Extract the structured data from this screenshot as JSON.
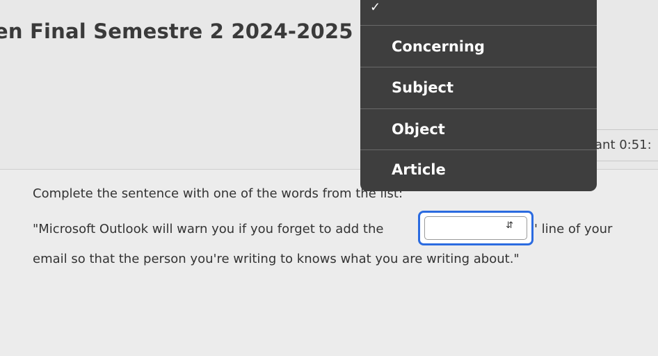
{
  "page": {
    "title": "en Final Semestre 2 2024-2025 (",
    "timer_text": "ant 0:51:"
  },
  "question": {
    "prompt": "Complete the sentence with one of the words from the list:",
    "sentence_before": "\"Microsoft Outlook will warn you if you forget to add the",
    "sentence_after": "' line of your",
    "sentence_line2": "email so that the person you're writing to knows what you are writing about.\"",
    "dropdown_value": ""
  },
  "menu": {
    "selected_index": -1,
    "items": [
      {
        "label": "Concerning"
      },
      {
        "label": "Subject"
      },
      {
        "label": "Object"
      },
      {
        "label": "Article"
      }
    ]
  },
  "colors": {
    "menu_bg": "#3e3e3e",
    "focus_ring": "#2b6be0"
  },
  "icons": {
    "check": "check-icon",
    "updown": "updown-arrows-icon"
  }
}
